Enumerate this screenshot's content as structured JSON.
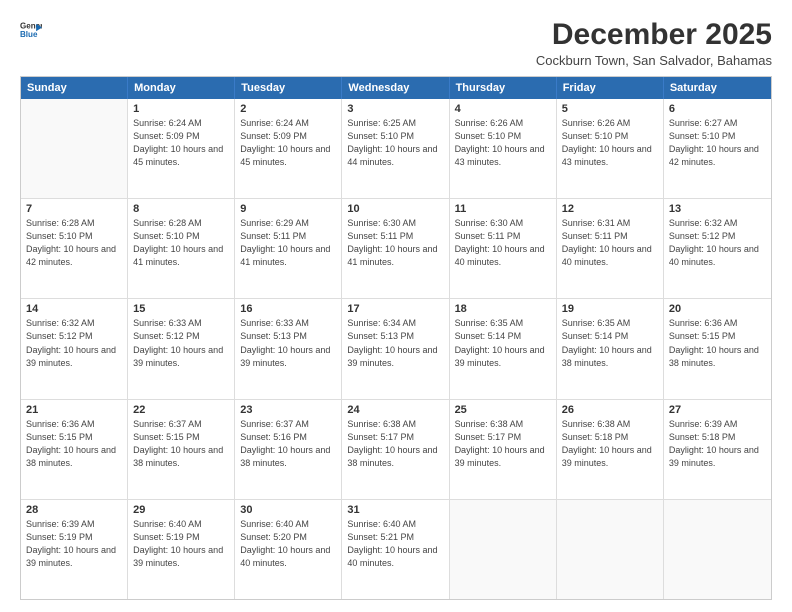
{
  "logo": {
    "line1": "General",
    "line2": "Blue",
    "icon": "▶"
  },
  "header": {
    "title": "December 2025",
    "location": "Cockburn Town, San Salvador, Bahamas"
  },
  "days_of_week": [
    "Sunday",
    "Monday",
    "Tuesday",
    "Wednesday",
    "Thursday",
    "Friday",
    "Saturday"
  ],
  "weeks": [
    [
      {
        "day": "",
        "empty": true
      },
      {
        "day": "1",
        "sunrise": "Sunrise: 6:24 AM",
        "sunset": "Sunset: 5:09 PM",
        "daylight": "Daylight: 10 hours and 45 minutes."
      },
      {
        "day": "2",
        "sunrise": "Sunrise: 6:24 AM",
        "sunset": "Sunset: 5:09 PM",
        "daylight": "Daylight: 10 hours and 45 minutes."
      },
      {
        "day": "3",
        "sunrise": "Sunrise: 6:25 AM",
        "sunset": "Sunset: 5:10 PM",
        "daylight": "Daylight: 10 hours and 44 minutes."
      },
      {
        "day": "4",
        "sunrise": "Sunrise: 6:26 AM",
        "sunset": "Sunset: 5:10 PM",
        "daylight": "Daylight: 10 hours and 43 minutes."
      },
      {
        "day": "5",
        "sunrise": "Sunrise: 6:26 AM",
        "sunset": "Sunset: 5:10 PM",
        "daylight": "Daylight: 10 hours and 43 minutes."
      },
      {
        "day": "6",
        "sunrise": "Sunrise: 6:27 AM",
        "sunset": "Sunset: 5:10 PM",
        "daylight": "Daylight: 10 hours and 42 minutes."
      }
    ],
    [
      {
        "day": "7",
        "sunrise": "Sunrise: 6:28 AM",
        "sunset": "Sunset: 5:10 PM",
        "daylight": "Daylight: 10 hours and 42 minutes."
      },
      {
        "day": "8",
        "sunrise": "Sunrise: 6:28 AM",
        "sunset": "Sunset: 5:10 PM",
        "daylight": "Daylight: 10 hours and 41 minutes."
      },
      {
        "day": "9",
        "sunrise": "Sunrise: 6:29 AM",
        "sunset": "Sunset: 5:11 PM",
        "daylight": "Daylight: 10 hours and 41 minutes."
      },
      {
        "day": "10",
        "sunrise": "Sunrise: 6:30 AM",
        "sunset": "Sunset: 5:11 PM",
        "daylight": "Daylight: 10 hours and 41 minutes."
      },
      {
        "day": "11",
        "sunrise": "Sunrise: 6:30 AM",
        "sunset": "Sunset: 5:11 PM",
        "daylight": "Daylight: 10 hours and 40 minutes."
      },
      {
        "day": "12",
        "sunrise": "Sunrise: 6:31 AM",
        "sunset": "Sunset: 5:11 PM",
        "daylight": "Daylight: 10 hours and 40 minutes."
      },
      {
        "day": "13",
        "sunrise": "Sunrise: 6:32 AM",
        "sunset": "Sunset: 5:12 PM",
        "daylight": "Daylight: 10 hours and 40 minutes."
      }
    ],
    [
      {
        "day": "14",
        "sunrise": "Sunrise: 6:32 AM",
        "sunset": "Sunset: 5:12 PM",
        "daylight": "Daylight: 10 hours and 39 minutes."
      },
      {
        "day": "15",
        "sunrise": "Sunrise: 6:33 AM",
        "sunset": "Sunset: 5:12 PM",
        "daylight": "Daylight: 10 hours and 39 minutes."
      },
      {
        "day": "16",
        "sunrise": "Sunrise: 6:33 AM",
        "sunset": "Sunset: 5:13 PM",
        "daylight": "Daylight: 10 hours and 39 minutes."
      },
      {
        "day": "17",
        "sunrise": "Sunrise: 6:34 AM",
        "sunset": "Sunset: 5:13 PM",
        "daylight": "Daylight: 10 hours and 39 minutes."
      },
      {
        "day": "18",
        "sunrise": "Sunrise: 6:35 AM",
        "sunset": "Sunset: 5:14 PM",
        "daylight": "Daylight: 10 hours and 39 minutes."
      },
      {
        "day": "19",
        "sunrise": "Sunrise: 6:35 AM",
        "sunset": "Sunset: 5:14 PM",
        "daylight": "Daylight: 10 hours and 38 minutes."
      },
      {
        "day": "20",
        "sunrise": "Sunrise: 6:36 AM",
        "sunset": "Sunset: 5:15 PM",
        "daylight": "Daylight: 10 hours and 38 minutes."
      }
    ],
    [
      {
        "day": "21",
        "sunrise": "Sunrise: 6:36 AM",
        "sunset": "Sunset: 5:15 PM",
        "daylight": "Daylight: 10 hours and 38 minutes."
      },
      {
        "day": "22",
        "sunrise": "Sunrise: 6:37 AM",
        "sunset": "Sunset: 5:15 PM",
        "daylight": "Daylight: 10 hours and 38 minutes."
      },
      {
        "day": "23",
        "sunrise": "Sunrise: 6:37 AM",
        "sunset": "Sunset: 5:16 PM",
        "daylight": "Daylight: 10 hours and 38 minutes."
      },
      {
        "day": "24",
        "sunrise": "Sunrise: 6:38 AM",
        "sunset": "Sunset: 5:17 PM",
        "daylight": "Daylight: 10 hours and 38 minutes."
      },
      {
        "day": "25",
        "sunrise": "Sunrise: 6:38 AM",
        "sunset": "Sunset: 5:17 PM",
        "daylight": "Daylight: 10 hours and 39 minutes."
      },
      {
        "day": "26",
        "sunrise": "Sunrise: 6:38 AM",
        "sunset": "Sunset: 5:18 PM",
        "daylight": "Daylight: 10 hours and 39 minutes."
      },
      {
        "day": "27",
        "sunrise": "Sunrise: 6:39 AM",
        "sunset": "Sunset: 5:18 PM",
        "daylight": "Daylight: 10 hours and 39 minutes."
      }
    ],
    [
      {
        "day": "28",
        "sunrise": "Sunrise: 6:39 AM",
        "sunset": "Sunset: 5:19 PM",
        "daylight": "Daylight: 10 hours and 39 minutes."
      },
      {
        "day": "29",
        "sunrise": "Sunrise: 6:40 AM",
        "sunset": "Sunset: 5:19 PM",
        "daylight": "Daylight: 10 hours and 39 minutes."
      },
      {
        "day": "30",
        "sunrise": "Sunrise: 6:40 AM",
        "sunset": "Sunset: 5:20 PM",
        "daylight": "Daylight: 10 hours and 40 minutes."
      },
      {
        "day": "31",
        "sunrise": "Sunrise: 6:40 AM",
        "sunset": "Sunset: 5:21 PM",
        "daylight": "Daylight: 10 hours and 40 minutes."
      },
      {
        "day": "",
        "empty": true
      },
      {
        "day": "",
        "empty": true
      },
      {
        "day": "",
        "empty": true
      }
    ]
  ]
}
